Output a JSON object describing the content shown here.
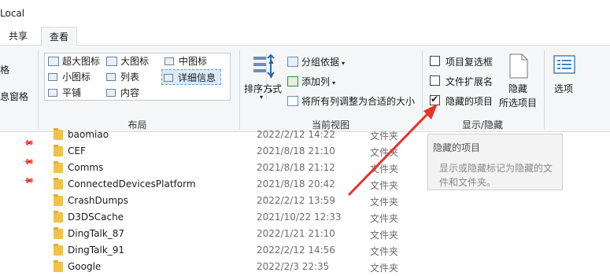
{
  "window": {
    "title": "Local"
  },
  "tabs": [
    {
      "label": "共享"
    },
    {
      "label": "查看"
    }
  ],
  "ribbon": {
    "left_partial": {
      "item1": "格",
      "item2": "息窗格"
    },
    "layout_group": {
      "label": "布局",
      "options": [
        {
          "label": "超大图标"
        },
        {
          "label": "大图标"
        },
        {
          "label": "中图标"
        },
        {
          "label": "小图标"
        },
        {
          "label": "列表"
        },
        {
          "label": "详细信息"
        },
        {
          "label": "平铺"
        },
        {
          "label": "内容"
        }
      ],
      "selected": "详细信息"
    },
    "current_view_group": {
      "label": "当前视图",
      "sort_by": "排序方式",
      "group_by": "分组依据",
      "add_column": "添加列",
      "fit_columns": "将所有列调整为合适的大小"
    },
    "show_hide_group": {
      "label": "显示/隐藏",
      "item_checkboxes": {
        "label": "项目复选框",
        "checked": false
      },
      "file_extensions": {
        "label": "文件扩展名",
        "checked": false
      },
      "hidden_items": {
        "label": "隐藏的项目",
        "checked": true
      },
      "hide_selected": {
        "line1": "隐藏",
        "line2": "所选项目"
      }
    },
    "options": {
      "label": "选项"
    }
  },
  "tooltip": {
    "title": "隐藏的项目",
    "body": "显示或隐藏标记为隐藏的文件和文件夹。"
  },
  "files": [
    {
      "name": "baomiao",
      "date": "2022/2/12 14:22",
      "type": "文件夹"
    },
    {
      "name": "CEF",
      "date": "2021/8/18 21:10",
      "type": "文件夹"
    },
    {
      "name": "Comms",
      "date": "2021/8/18 21:12",
      "type": "文件夹"
    },
    {
      "name": "ConnectedDevicesPlatform",
      "date": "2021/8/18 20:42",
      "type": "文件夹"
    },
    {
      "name": "CrashDumps",
      "date": "2022/2/12 13:59",
      "type": "文件夹"
    },
    {
      "name": "D3DSCache",
      "date": "2021/10/22 12:33",
      "type": "文件夹"
    },
    {
      "name": "DingTalk_87",
      "date": "2022/1/21 21:10",
      "type": "文件夹"
    },
    {
      "name": "DingTalk_91",
      "date": "2022/2/12 14:56",
      "type": "文件夹"
    },
    {
      "name": "Google",
      "date": "2022/2/3 22:35",
      "type": "文件夹"
    }
  ],
  "colors": {
    "annotation_arrow": "#e8332a",
    "ribbon_bg": "#f5f6f7",
    "folder": "#f0c24a"
  }
}
